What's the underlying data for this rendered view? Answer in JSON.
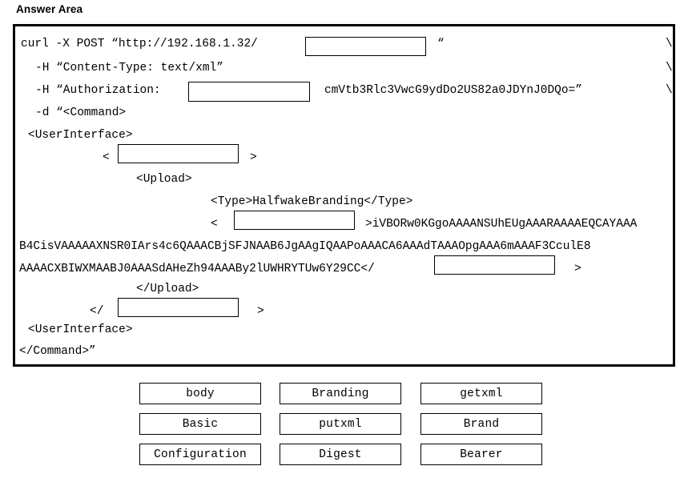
{
  "page": {
    "title": "Answer Area"
  },
  "code": {
    "lines": [
      {
        "id": "l1a",
        "text": "curl -X POST “http://192.168.1.32/"
      },
      {
        "id": "l1b",
        "text": "“"
      },
      {
        "id": "l1c",
        "text": "\\"
      },
      {
        "id": "l2",
        "text": "-H “Content-Type: text/xml”"
      },
      {
        "id": "l2c",
        "text": "\\"
      },
      {
        "id": "l3a",
        "text": "-H “Authorization:"
      },
      {
        "id": "l3b",
        "text": "cmVtb3Rlc3VwcG9ydDo2US82a0JDYnJ0DQo=”"
      },
      {
        "id": "l3c",
        "text": "\\"
      },
      {
        "id": "l4",
        "text": "-d “<Command>"
      },
      {
        "id": "l5",
        "text": "<UserInterface>"
      },
      {
        "id": "l6a",
        "text": "<"
      },
      {
        "id": "l6b",
        "text": ">"
      },
      {
        "id": "l7",
        "text": "<Upload>"
      },
      {
        "id": "l8",
        "text": "<Type>HalfwakeBranding</Type>"
      },
      {
        "id": "l9a",
        "text": "<"
      },
      {
        "id": "l9b",
        "text": ">iVBORw0KGgoAAAANSUhEUgAAARAAAAEQCAYAAA"
      },
      {
        "id": "l10",
        "text": "B4CisVAAAAAXNSR0IArs4c6QAAACBjSFJNAAB6JgAAgIQAAPoAAACA6AAAdTAAAOpgAAA6mAAAF3CculE8"
      },
      {
        "id": "l11a",
        "text": "AAAACXBIWXMAABJ0AAASdAHeZh94AAABy2lUWHRYTUw6Y29CC</"
      },
      {
        "id": "l11b",
        "text": ">"
      },
      {
        "id": "l12",
        "text": "</Upload>"
      },
      {
        "id": "l13a",
        "text": "</"
      },
      {
        "id": "l13b",
        "text": ">"
      },
      {
        "id": "l14",
        "text": "<UserInterface>"
      },
      {
        "id": "l15",
        "text": "</Command>”"
      }
    ],
    "blanks": [
      {
        "id": "blank-url-path",
        "name": "blank-url-path",
        "value": ""
      },
      {
        "id": "blank-auth-scheme",
        "name": "blank-auth-scheme",
        "value": ""
      },
      {
        "id": "blank-open-tag-1",
        "name": "blank-open-tag-1",
        "value": ""
      },
      {
        "id": "blank-open-tag-2",
        "name": "blank-open-tag-2",
        "value": ""
      },
      {
        "id": "blank-close-tag-1",
        "name": "blank-close-tag-1",
        "value": ""
      },
      {
        "id": "blank-close-tag-2",
        "name": "blank-close-tag-2",
        "value": ""
      }
    ]
  },
  "options": {
    "items": [
      {
        "label": "body",
        "row": 0,
        "col": 0
      },
      {
        "label": "Branding",
        "row": 0,
        "col": 1
      },
      {
        "label": "getxml",
        "row": 0,
        "col": 2
      },
      {
        "label": "Basic",
        "row": 1,
        "col": 0
      },
      {
        "label": "putxml",
        "row": 1,
        "col": 1
      },
      {
        "label": "Brand",
        "row": 1,
        "col": 2
      },
      {
        "label": "Configuration",
        "row": 2,
        "col": 0
      },
      {
        "label": "Digest",
        "row": 2,
        "col": 1
      },
      {
        "label": "Bearer",
        "row": 2,
        "col": 2
      }
    ]
  },
  "colors": {
    "border": "#000000",
    "background": "#ffffff",
    "text": "#000000"
  }
}
